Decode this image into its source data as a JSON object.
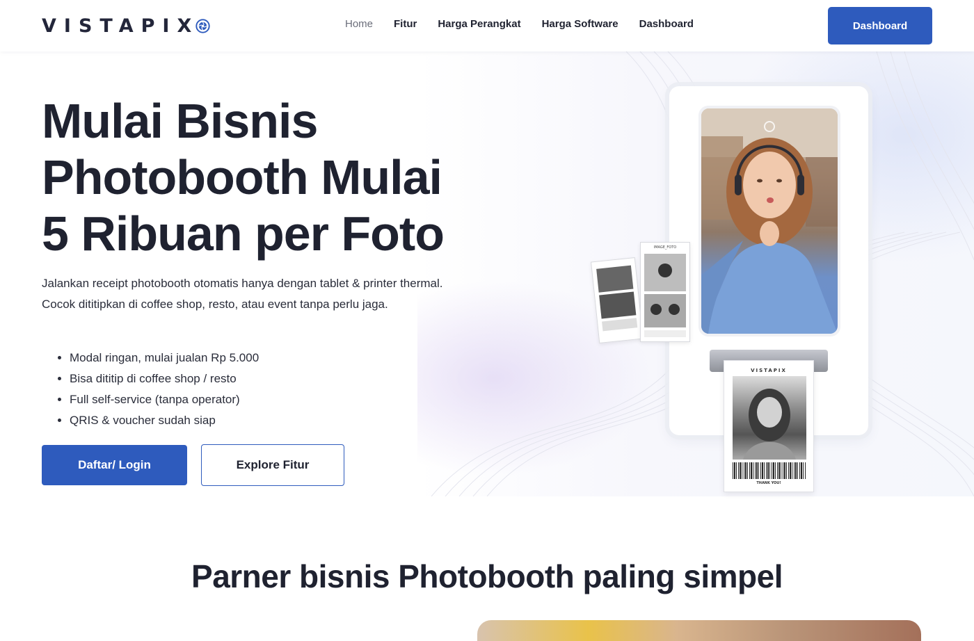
{
  "header": {
    "logo_text": "VISTAPIX",
    "logo_icon": "aperture-icon",
    "nav": [
      {
        "label": "Home",
        "active": true
      },
      {
        "label": "Fitur",
        "active": false
      },
      {
        "label": "Harga Perangkat",
        "active": false
      },
      {
        "label": "Harga Software",
        "active": false
      },
      {
        "label": "Dashboard",
        "active": false
      }
    ],
    "cta_label": "Dashboard"
  },
  "hero": {
    "title": "Mulai Bisnis Photobooth Mulai 5 Ribuan per Foto",
    "description": "Jalankan receipt photobooth otomatis hanya dengan tablet & printer thermal. Cocok dititipkan di coffee shop, resto, atau event tanpa perlu jaga.",
    "bullets": [
      "Modal ringan, mulai jualan Rp 5.000",
      "Bisa dititip di coffee shop / resto",
      "Full self-service (tanpa operator)",
      "QRIS & voucher sudah siap"
    ],
    "primary_button": "Daftar/ Login",
    "secondary_button": "Explore Fitur",
    "illustration": {
      "receipt_brand": "VISTAPIX",
      "receipt_footer": "THANK YOU!",
      "strip_label": "IMAGE_FOTO"
    }
  },
  "section2": {
    "title": "Parner bisnis Photobooth paling simpel"
  },
  "colors": {
    "accent": "#2e5bbd",
    "text": "#1f2230",
    "nav_active": "#6a6d7a"
  }
}
